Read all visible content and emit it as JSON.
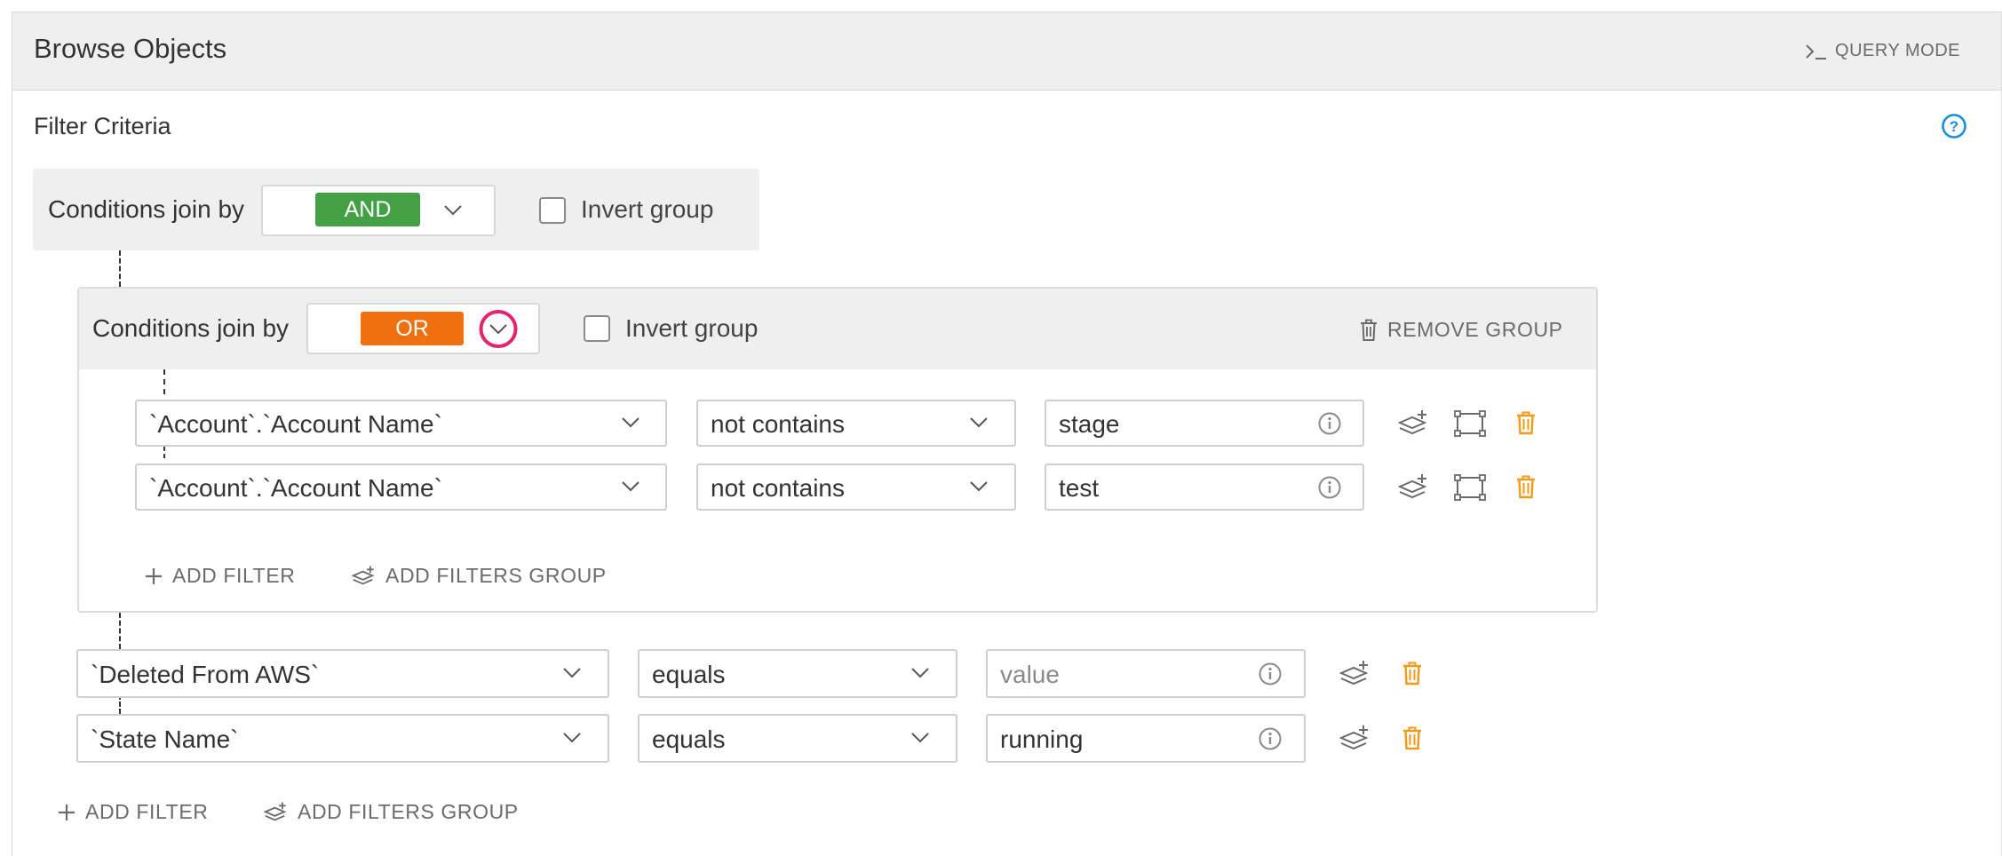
{
  "header": {
    "title": "Browse Objects",
    "query_mode_label": "QUERY MODE"
  },
  "filter_criteria_label": "Filter Criteria",
  "colors": {
    "and": "#44a047",
    "or": "#f0700f",
    "accent": "#1a8fd8",
    "delete": "#f09a1a",
    "focus": "#e5246f"
  },
  "top_group": {
    "join_label": "Conditions join by",
    "join_value": "AND",
    "invert_label": "Invert group",
    "invert_checked": false
  },
  "sub_group": {
    "join_label": "Conditions join by",
    "join_value": "OR",
    "invert_label": "Invert group",
    "invert_checked": false,
    "remove_label": "REMOVE GROUP",
    "filters": [
      {
        "field": "`Account`.`Account Name`",
        "operator": "not contains",
        "value": "stage"
      },
      {
        "field": "`Account`.`Account Name`",
        "operator": "not contains",
        "value": "test"
      }
    ],
    "add_filter_label": "ADD FILTER",
    "add_group_label": "ADD FILTERS GROUP"
  },
  "filters": [
    {
      "field": "`Deleted From AWS`",
      "operator": "equals",
      "value": "",
      "placeholder": "value"
    },
    {
      "field": "`State Name`",
      "operator": "equals",
      "value": "running",
      "placeholder": "value"
    }
  ],
  "add_filter_label": "ADD FILTER",
  "add_group_label": "ADD FILTERS GROUP",
  "icons": [
    "terminal-icon",
    "help-icon",
    "chevron-down-icon",
    "trash-icon",
    "info-icon",
    "add-layers-icon",
    "group-select-icon",
    "plus-icon"
  ]
}
